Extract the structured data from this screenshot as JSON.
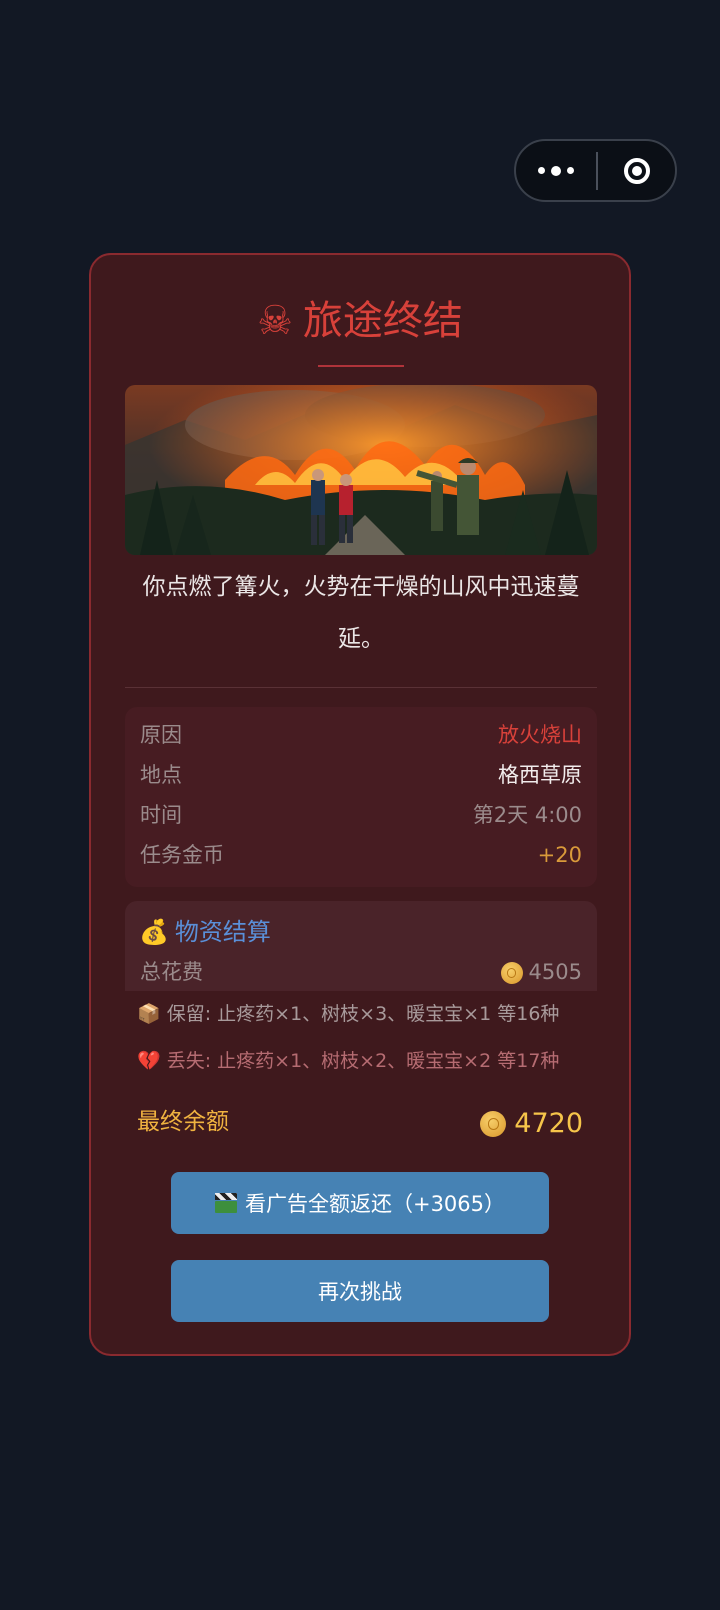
{
  "result": {
    "title": "旅途终结",
    "description": "你点燃了篝火，火势在干燥的山风中迅速蔓延。"
  },
  "details": [
    {
      "key": "原因",
      "value": "放火烧山",
      "color": "#d8413a"
    },
    {
      "key": "地点",
      "value": "格西草原",
      "color": "#f2eded"
    },
    {
      "key": "时间",
      "value": "第2天 4:00",
      "color": "#9b8b8c"
    },
    {
      "key": "任务金币",
      "value": "+20",
      "color": "#d99a3a"
    }
  ],
  "settlement": {
    "heading": "物资结算",
    "total_cost_label": "总花费",
    "total_cost_value": "4505",
    "kept": "保留: 止疼药×1、树枝×3、暖宝宝×1 等16种",
    "lost": "丢失: 止疼药×1、树枝×2、暖宝宝×2 等17种",
    "final_label": "最终余额",
    "final_value": "4720"
  },
  "buttons": {
    "ad_refund": "看广告全额返还（+3065）",
    "retry": "再次挑战"
  },
  "colors": {
    "page_bg": "#121824",
    "card_bg": "#3f191d",
    "accent_red": "#d8413a",
    "button_blue": "#4682b4",
    "gold": "#f6c54a"
  },
  "icons": [
    "more-icon",
    "close-target-icon",
    "skull-crossbones-icon",
    "money-bag-icon",
    "coin-icon",
    "package-icon",
    "broken-heart-icon",
    "clapperboard-icon"
  ]
}
